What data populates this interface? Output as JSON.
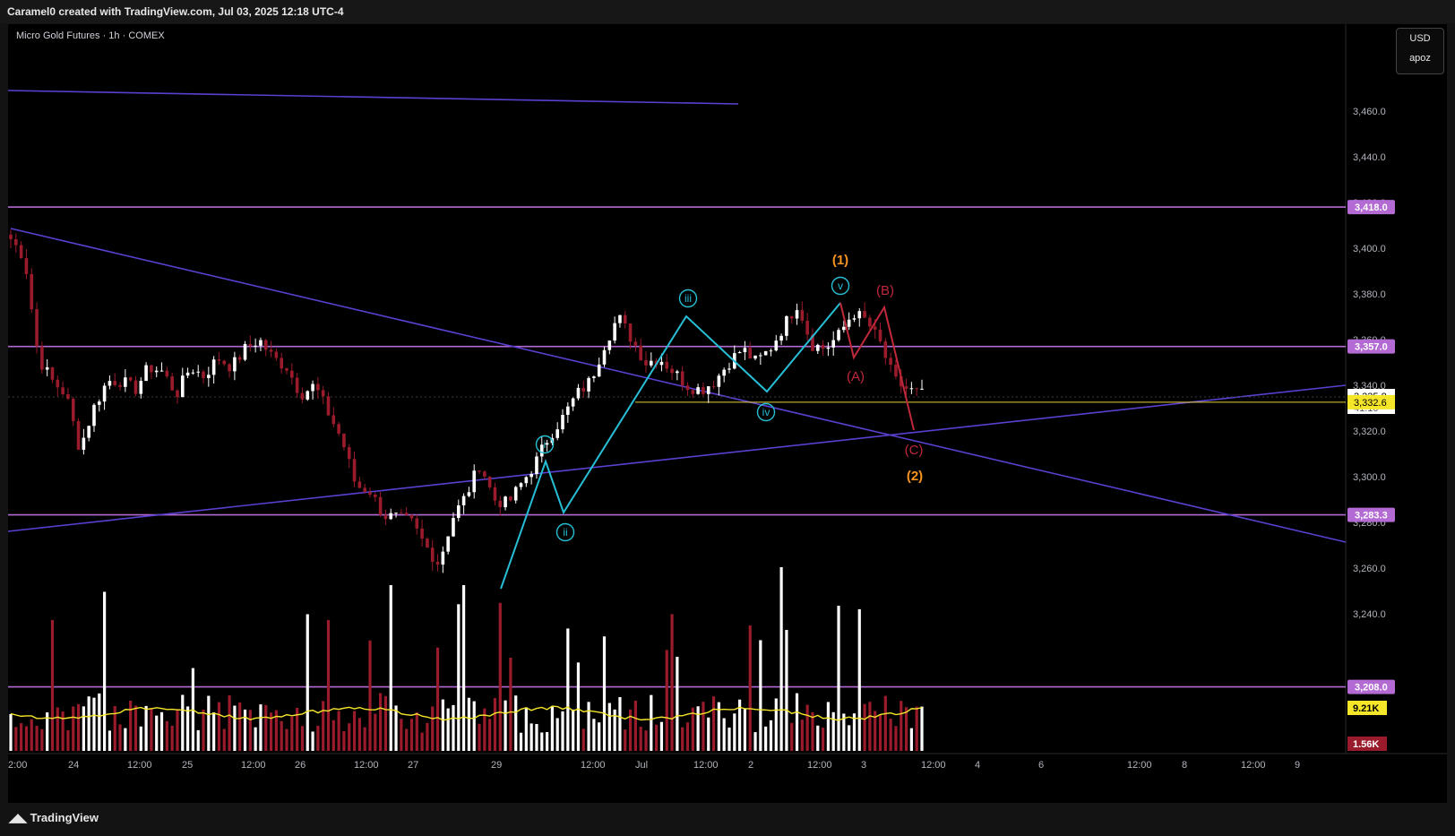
{
  "header": {
    "title": "Caramel0 created with TradingView.com, Jul 03, 2025 12:18 UTC-4"
  },
  "legend": {
    "symbol": "Micro Gold Futures · 1h · COMEX"
  },
  "scale_box": {
    "currency": "USD",
    "mode": "apoz"
  },
  "footer": {
    "brand": "TradingView"
  },
  "colors": {
    "background": "#000000",
    "horizontal_level": "#b36ad3",
    "trendline": "#5b3fd0",
    "impulse_wave": "#27bfd6",
    "correction_wave": "#c0283c",
    "wave_degree_label": "#f7931e",
    "up_candle": "#ffffff",
    "down_candle": "#9a1b2b",
    "volume_ma": "#f5e62a"
  },
  "chart_data": {
    "type": "candlestick",
    "title": "Micro Gold Futures · 1h · COMEX",
    "currency": "USD",
    "ylim": [
      3244,
      3488
    ],
    "y_ticks": [
      3240.0,
      3260.0,
      3280.0,
      3300.0,
      3320.0,
      3340.0,
      3360.0,
      3380.0,
      3400.0,
      3420.0,
      3440.0,
      3460.0
    ],
    "y_tick_labels": [
      "3,240.0",
      "3,260.0",
      "3,280.0",
      "3,300.0",
      "3,320.0",
      "3,340.0",
      "3,360.0",
      "3,380.0",
      "3,400.0",
      "3,420.0",
      "3,440.0",
      "3,460.0"
    ],
    "x_tick_labels": [
      "2:00",
      "24",
      "12:00",
      "25",
      "12:00",
      "26",
      "12:00",
      "27",
      "29",
      "12:00",
      "Jul",
      "12:00",
      "2",
      "12:00",
      "3",
      "12:00",
      "4",
      "6",
      "12:00",
      "8",
      "12:00",
      "9"
    ],
    "horizontal_levels": [
      3418.0,
      3357.0,
      3283.3,
      3208.0
    ],
    "horizontal_level_labels": [
      "3,418.0",
      "3,357.0",
      "3,283.3",
      "3,208.0"
    ],
    "last_price": "3,335.8",
    "countdown": "41:10",
    "prev_close": "3,332.6",
    "prev_close_value": 3332.6,
    "volume_labels": [
      "9.21K",
      "1.56K"
    ],
    "price_path": [
      3404,
      3396,
      3352,
      3342,
      3336,
      3312,
      3330,
      3342,
      3342,
      3338,
      3348,
      3346,
      3336,
      3348,
      3344,
      3352,
      3348,
      3356,
      3360,
      3352,
      3348,
      3336,
      3340,
      3328,
      3316,
      3296,
      3294,
      3283,
      3282,
      3280,
      3270,
      3262,
      3282,
      3292,
      3306,
      3290,
      3288,
      3297,
      3306,
      3318,
      3326,
      3336,
      3342,
      3358,
      3370,
      3360,
      3350,
      3352,
      3346,
      3340,
      3338,
      3342,
      3350,
      3356,
      3350,
      3356,
      3366,
      3376,
      3358,
      3356,
      3362,
      3372,
      3368,
      3358,
      3342,
      3338,
      3336
    ],
    "elliott_impulse": [
      "i",
      "ii",
      "iii",
      "iv",
      "v"
    ],
    "elliott_correction": [
      "(A)",
      "(B)",
      "(C)"
    ],
    "wave_degree": [
      "(1)",
      "(2)"
    ],
    "volume_ma_level": "9.21K"
  }
}
